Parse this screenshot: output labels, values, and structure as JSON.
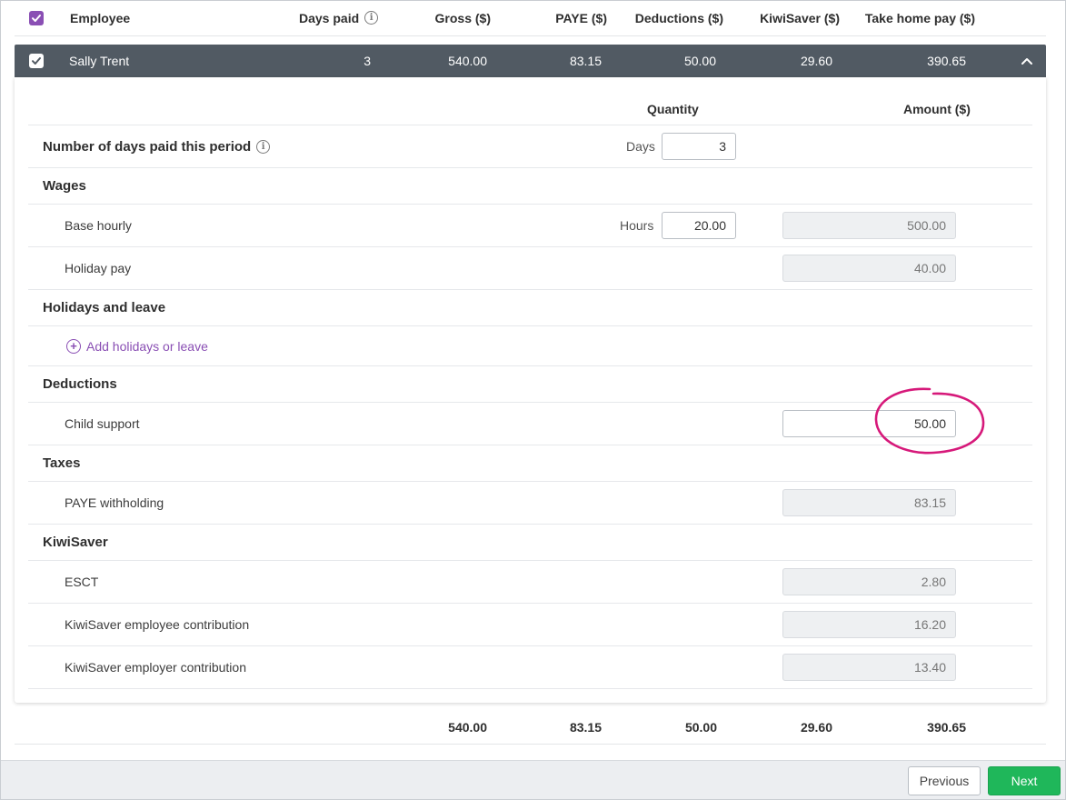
{
  "header": {
    "employee": "Employee",
    "days_paid": "Days paid",
    "gross": "Gross ($)",
    "paye": "PAYE ($)",
    "deductions": "Deductions ($)",
    "kiwisaver": "KiwiSaver ($)",
    "take_home": "Take home pay ($)"
  },
  "employee_row": {
    "name": "Sally Trent",
    "days_paid": "3",
    "gross": "540.00",
    "paye": "83.15",
    "deductions": "50.00",
    "kiwisaver": "29.60",
    "take_home": "390.65"
  },
  "detail_header": {
    "quantity": "Quantity",
    "amount": "Amount ($)"
  },
  "days_row": {
    "label": "Number of days paid this period",
    "unit": "Days",
    "value": "3"
  },
  "wages": {
    "title": "Wages",
    "base_hourly": {
      "label": "Base hourly",
      "unit": "Hours",
      "quantity": "20.00",
      "amount": "500.00"
    },
    "holiday_pay": {
      "label": "Holiday pay",
      "amount": "40.00"
    }
  },
  "holidays": {
    "title": "Holidays and leave",
    "add_link": "Add holidays or leave"
  },
  "deductions": {
    "title": "Deductions",
    "child_support": {
      "label": "Child support",
      "amount": "50.00"
    }
  },
  "taxes": {
    "title": "Taxes",
    "paye_withholding": {
      "label": "PAYE withholding",
      "amount": "83.15"
    }
  },
  "kiwisaver": {
    "title": "KiwiSaver",
    "esct": {
      "label": "ESCT",
      "amount": "2.80"
    },
    "employee_contribution": {
      "label": "KiwiSaver employee contribution",
      "amount": "16.20"
    },
    "employer_contribution": {
      "label": "KiwiSaver employer contribution",
      "amount": "13.40"
    }
  },
  "totals": {
    "gross": "540.00",
    "paye": "83.15",
    "deductions": "50.00",
    "kiwisaver": "29.60",
    "take_home": "390.65"
  },
  "footer": {
    "previous": "Previous",
    "next": "Next"
  },
  "colors": {
    "accent": "#8a4fb4",
    "bar": "#515a63",
    "next_button": "#1fb75a",
    "annotation": "#d6197a"
  }
}
